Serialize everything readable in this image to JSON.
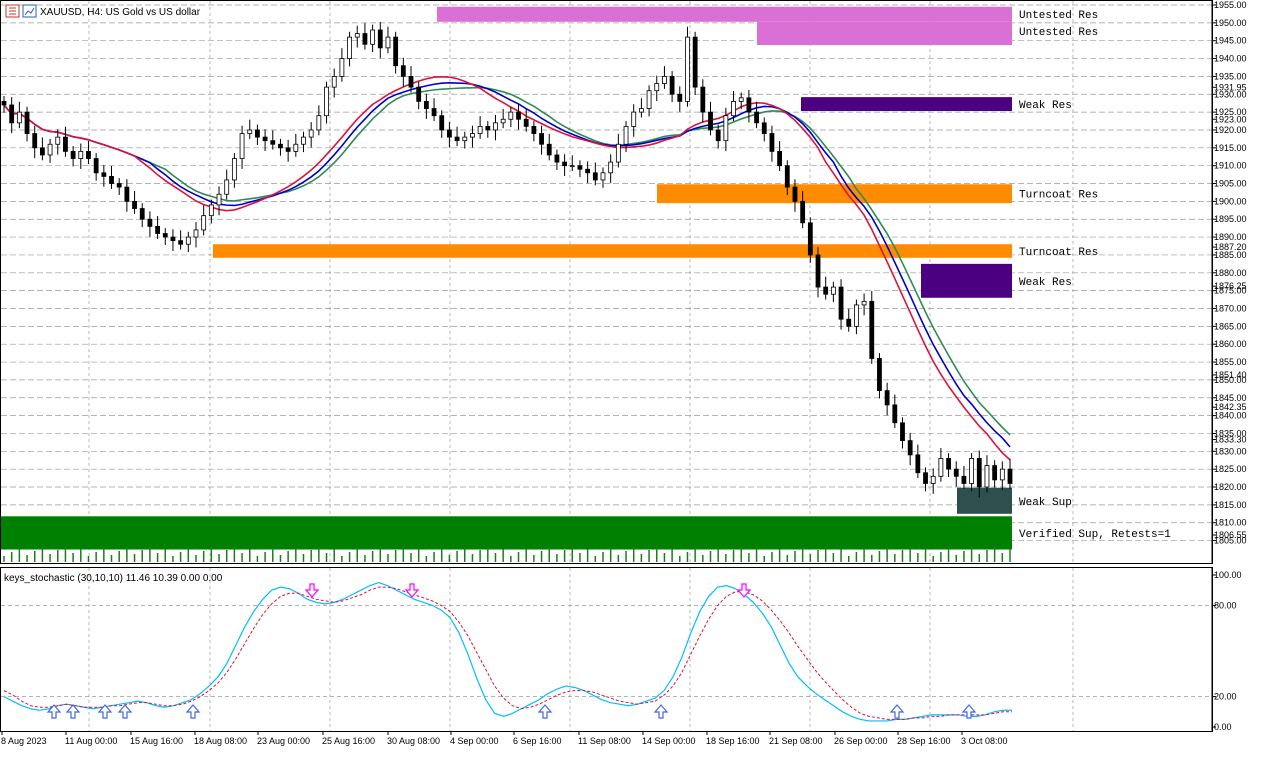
{
  "header": {
    "symbol": "XAUUSD",
    "timeframe": "H4",
    "description": "US Gold vs US dollar",
    "text": "XAUUSD, H4: US Gold vs US dollar"
  },
  "price_axis": {
    "ticks": [
      "1955.00",
      "1950.00",
      "1945.00",
      "1940.00",
      "1935.00",
      "1931.95",
      "1930.00",
      "1925.00",
      "1923.00",
      "1920.00",
      "1915.00",
      "1910.00",
      "1905.00",
      "1900.00",
      "1895.00",
      "1890.00",
      "1887.20",
      "1885.00",
      "1880.00",
      "1876.25",
      "1875.00",
      "1870.00",
      "1865.00",
      "1860.00",
      "1855.00",
      "1851.40",
      "1850.00",
      "1845.00",
      "1842.35",
      "1840.00",
      "1835.00",
      "1833.30",
      "1830.00",
      "1825.00",
      "1820.00",
      "1815.00",
      "1810.00",
      "1806.55",
      "1805.00"
    ],
    "ylim": [
      1802,
      1956
    ]
  },
  "time_axis": {
    "labels": [
      "8 Aug 2023",
      "11 Aug 00:00",
      "15 Aug 16:00",
      "18 Aug 08:00",
      "23 Aug 00:00",
      "25 Aug 16:00",
      "30 Aug 08:00",
      "4 Sep 00:00",
      "6 Sep 16:00",
      "11 Sep 08:00",
      "14 Sep 00:00",
      "18 Sep 16:00",
      "21 Sep 08:00",
      "26 Sep 00:00",
      "28 Sep 16:00",
      "3 Oct 08:00"
    ]
  },
  "zones": [
    {
      "label": "Untested Res",
      "color": "#DA70D6",
      "high": 1954.5,
      "low": 1950.3
    },
    {
      "label": "Untested Res",
      "color": "#DA70D6",
      "high": 1950.3,
      "low": 1943.8
    },
    {
      "label": "Weak Res",
      "color": "#4B0082",
      "high": 1929.2,
      "low": 1925.3
    },
    {
      "label": "Turncoat Res",
      "color": "#FF8C00",
      "high": 1904.8,
      "low": 1899.5
    },
    {
      "label": "Turncoat Res",
      "color": "#FF8C00",
      "high": 1888.0,
      "low": 1884.2
    },
    {
      "label": "Weak Res",
      "color": "#4B0082",
      "high": 1882.5,
      "low": 1873.0
    },
    {
      "label": "Weak Sup",
      "color": "#2F4F4F",
      "high": 1819.8,
      "low": 1812.5
    },
    {
      "label": "Verified Sup, Retests=1",
      "color": "#008000",
      "high": 1811.8,
      "low": 1802.5
    }
  ],
  "moving_averages": [
    {
      "color": "#2E8B57"
    },
    {
      "color": "#0000CD"
    },
    {
      "color": "#DC143C"
    }
  ],
  "candle_colors": {
    "up": "#000000",
    "down": "#000000"
  },
  "indicator": {
    "header": "keys_stochastic (30,10,10) 11.46 10.39 0.00 0.00",
    "name": "keys_stochastic",
    "params": "(30,10,10)",
    "values": [
      11.46,
      10.39,
      0.0,
      0.0
    ],
    "ticks": [
      "100.00",
      "80.00",
      "20.00",
      "0.00"
    ],
    "main_color": "#00BFFF",
    "signal_color": "#DC143C",
    "buy_arrow_color": "#4169E1",
    "sell_arrow_color": "#FF00FF"
  },
  "chart_data": {
    "type": "candlestick",
    "title": "XAUUSD, H4: US Gold vs US dollar",
    "series": [
      {
        "name": "XAUUSD",
        "kind": "ohlc",
        "close": [
          1927,
          1922,
          1925,
          1919,
          1915,
          1913,
          1916,
          1918,
          1914,
          1912,
          1914,
          1912,
          1908,
          1907,
          1905,
          1904,
          1900,
          1898,
          1895,
          1893,
          1891,
          1890,
          1889,
          1888,
          1890,
          1892,
          1896,
          1899,
          1902,
          1906,
          1912,
          1919,
          1920,
          1918,
          1917,
          1916,
          1915,
          1914,
          1916,
          1918,
          1920,
          1924,
          1932,
          1935,
          1940,
          1946,
          1947,
          1944,
          1948,
          1943,
          1946,
          1938,
          1935,
          1932,
          1928,
          1926,
          1924,
          1920,
          1918,
          1917,
          1918,
          1919,
          1921,
          1920,
          1922,
          1923,
          1925,
          1923,
          1921,
          1919,
          1916,
          1913,
          1911,
          1910,
          1910,
          1909,
          1908,
          1906,
          1908,
          1911,
          1916,
          1921,
          1925,
          1926,
          1931,
          1933,
          1935,
          1930,
          1928,
          1946,
          1932,
          1925,
          1920,
          1917,
          1924,
          1928,
          1929,
          1925,
          1922,
          1919,
          1914,
          1910,
          1904,
          1900,
          1894,
          1885,
          1876,
          1874,
          1876,
          1867,
          1865,
          1871,
          1872,
          1856,
          1847,
          1843,
          1838,
          1833,
          1829,
          1824,
          1821,
          1823,
          1828,
          1825,
          1823,
          1821,
          1828,
          1820,
          1826,
          1822,
          1825,
          1821
        ]
      }
    ],
    "stochastic": {
      "main": [
        20,
        17,
        14,
        12,
        11,
        12,
        14,
        15,
        14,
        13,
        12,
        13,
        14,
        15,
        16,
        17,
        16,
        14,
        13,
        14,
        16,
        18,
        22,
        27,
        33,
        42,
        54,
        66,
        76,
        84,
        90,
        92,
        91,
        88,
        84,
        82,
        81,
        82,
        84,
        87,
        90,
        93,
        95,
        93,
        90,
        87,
        84,
        82,
        80,
        77,
        72,
        62,
        48,
        32,
        18,
        9,
        7,
        9,
        12,
        15,
        18,
        22,
        25,
        27,
        26,
        24,
        21,
        18,
        16,
        15,
        14,
        15,
        17,
        19,
        24,
        33,
        46,
        62,
        76,
        86,
        92,
        93,
        91,
        87,
        82,
        75,
        66,
        54,
        42,
        33,
        27,
        22,
        18,
        14,
        10,
        7,
        5,
        4,
        4,
        4,
        5,
        5,
        6,
        7,
        8,
        8,
        8,
        8,
        7,
        7,
        8,
        10,
        11,
        11
      ],
      "signal": [
        24,
        21,
        17,
        14,
        13,
        13,
        14,
        15,
        14,
        13,
        13,
        13,
        14,
        14,
        15,
        16,
        16,
        15,
        14,
        14,
        15,
        17,
        20,
        24,
        29,
        36,
        45,
        55,
        65,
        74,
        81,
        86,
        88,
        88,
        86,
        84,
        83,
        82,
        83,
        85,
        87,
        90,
        92,
        92,
        91,
        89,
        87,
        85,
        83,
        80,
        76,
        69,
        60,
        49,
        38,
        27,
        19,
        14,
        12,
        13,
        15,
        18,
        21,
        23,
        24,
        24,
        23,
        21,
        19,
        17,
        16,
        15,
        16,
        17,
        21,
        27,
        36,
        48,
        60,
        71,
        80,
        86,
        89,
        89,
        87,
        83,
        77,
        70,
        62,
        53,
        45,
        37,
        30,
        24,
        18,
        13,
        9,
        7,
        6,
        5,
        5,
        5,
        6,
        6,
        7,
        7,
        8,
        8,
        8,
        8,
        8,
        9,
        10,
        10
      ]
    },
    "ylim": [
      1802,
      1956
    ]
  }
}
